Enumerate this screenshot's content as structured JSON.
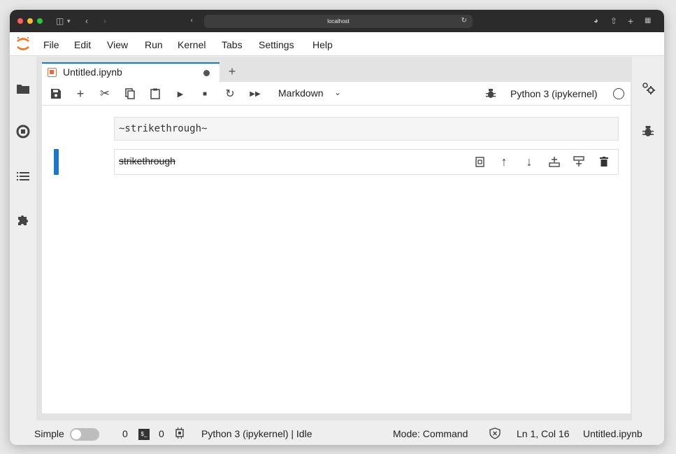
{
  "browser": {
    "url": "localhost"
  },
  "menubar": {
    "items": [
      "File",
      "Edit",
      "View",
      "Run",
      "Kernel",
      "Tabs",
      "Settings",
      "Help"
    ]
  },
  "tabs": {
    "active_title": "Untitled.ipynb",
    "new_tab": "+"
  },
  "toolbar": {
    "cell_type": "Markdown",
    "kernel": "Python 3 (ipykernel)"
  },
  "cells": [
    {
      "source": "~strikethrough~"
    },
    {
      "rendered": "strikethrough"
    }
  ],
  "statusbar": {
    "mode_label": "Simple",
    "terminals_count": "0",
    "kernels_count": "0",
    "kernel_status": "Python 3 (ipykernel) | Idle",
    "mode": "Mode: Command",
    "cursor": "Ln 1, Col 16",
    "filename": "Untitled.ipynb"
  },
  "colors": {
    "accent": "#1976d2",
    "notebook_icon": "#e46e3a"
  }
}
